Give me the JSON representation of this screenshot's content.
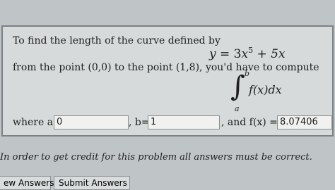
{
  "problem": {
    "intro": "To find the length of the curve defined by",
    "equation": {
      "lhs": "y",
      "eq": "=",
      "term1_coef": "3",
      "term1_var": "x",
      "term1_exp": "5",
      "plus": "+",
      "term2": "5x"
    },
    "from_text": "from the point (0,0) to the point (1,8), you'd have to compute",
    "integral": {
      "sign": "∫",
      "upper": "b",
      "lower": "a",
      "integrand": "f(x)dx"
    }
  },
  "answers": {
    "where_label": "where a=",
    "a_value": "0",
    "b_label": ", b=",
    "b_value": "1",
    "f_label": ", and f(x) =",
    "f_value": "8.07406"
  },
  "footer": {
    "note": "In order to get credit for this problem all answers must be correct."
  },
  "buttons": {
    "preview": "ew Answers",
    "submit": "Submit Answers"
  }
}
